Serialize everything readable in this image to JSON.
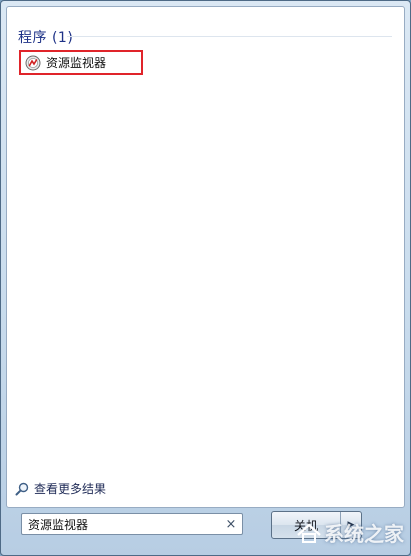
{
  "results": {
    "group_header": "程序 (1)",
    "items": [
      {
        "label": "资源监视器",
        "icon": "resource-monitor-icon"
      }
    ]
  },
  "see_more": {
    "label": "查看更多结果",
    "icon": "magnifier-icon"
  },
  "search": {
    "value": "资源监视器",
    "clear_glyph": "×"
  },
  "shutdown": {
    "label": "关机",
    "arrow_glyph": "▶"
  },
  "watermark": {
    "text": "系统之家",
    "icon": "logo-icon"
  },
  "colors": {
    "highlight_border": "#e0242a",
    "group_header": "#1e3287",
    "frame_bg": "#c9dced"
  }
}
